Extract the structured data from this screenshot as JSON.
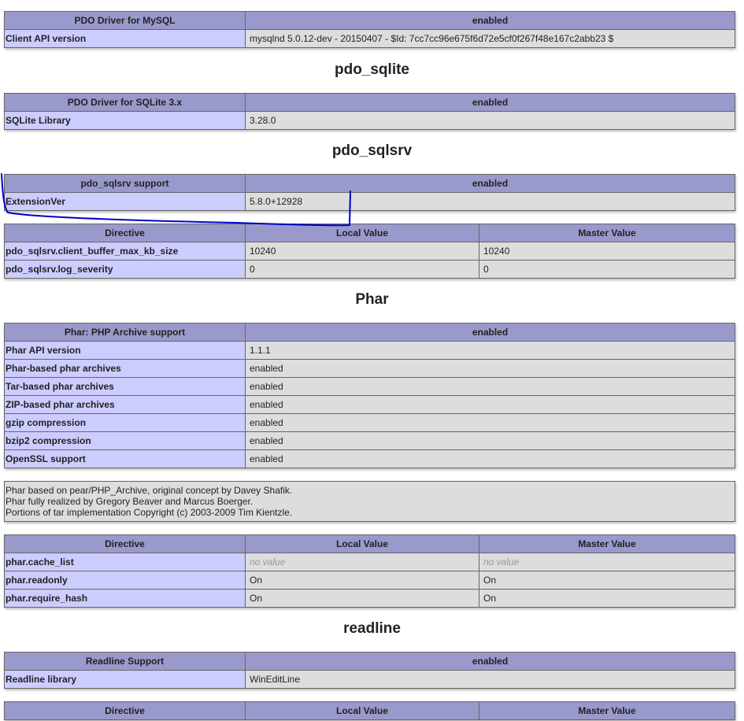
{
  "pdo_mysql": {
    "header": [
      "PDO Driver for MySQL",
      "enabled"
    ],
    "rows": [
      [
        "Client API version",
        "mysqlnd 5.0.12-dev - 20150407 - $Id: 7cc7cc96e675f6d72e5cf0f267f48e167c2abb23 $"
      ]
    ]
  },
  "pdo_sqlite": {
    "title": "pdo_sqlite",
    "header": [
      "PDO Driver for SQLite 3.x",
      "enabled"
    ],
    "rows": [
      [
        "SQLite Library",
        "3.28.0"
      ]
    ]
  },
  "pdo_sqlsrv": {
    "title": "pdo_sqlsrv",
    "header": [
      "pdo_sqlsrv support",
      "enabled"
    ],
    "rows": [
      [
        "ExtensionVer",
        "5.8.0+12928"
      ]
    ],
    "directives": {
      "header": [
        "Directive",
        "Local Value",
        "Master Value"
      ],
      "rows": [
        [
          "pdo_sqlsrv.client_buffer_max_kb_size",
          "10240",
          "10240"
        ],
        [
          "pdo_sqlsrv.log_severity",
          "0",
          "0"
        ]
      ]
    }
  },
  "phar": {
    "title": "Phar",
    "header": [
      "Phar: PHP Archive support",
      "enabled"
    ],
    "rows": [
      [
        "Phar API version",
        "1.1.1"
      ],
      [
        "Phar-based phar archives",
        "enabled"
      ],
      [
        "Tar-based phar archives",
        "enabled"
      ],
      [
        "ZIP-based phar archives",
        "enabled"
      ],
      [
        "gzip compression",
        "enabled"
      ],
      [
        "bzip2 compression",
        "enabled"
      ],
      [
        "OpenSSL support",
        "enabled"
      ]
    ],
    "notes": [
      "Phar based on pear/PHP_Archive, original concept by Davey Shafik.",
      "Phar fully realized by Gregory Beaver and Marcus Boerger.",
      "Portions of tar implementation Copyright (c) 2003-2009 Tim Kientzle."
    ],
    "directives": {
      "header": [
        "Directive",
        "Local Value",
        "Master Value"
      ],
      "rows": [
        [
          "phar.cache_list",
          "no value",
          "no value"
        ],
        [
          "phar.readonly",
          "On",
          "On"
        ],
        [
          "phar.require_hash",
          "On",
          "On"
        ]
      ]
    }
  },
  "readline": {
    "title": "readline",
    "header": [
      "Readline Support",
      "enabled"
    ],
    "rows": [
      [
        "Readline library",
        "WinEditLine"
      ]
    ],
    "directives": {
      "header": [
        "Directive",
        "Local Value",
        "Master Value"
      ]
    }
  },
  "colors": {
    "header_bg": "#9999cc",
    "key_bg": "#ccccff",
    "value_bg": "#dddddd",
    "annotation_stroke": "#0000c8"
  }
}
